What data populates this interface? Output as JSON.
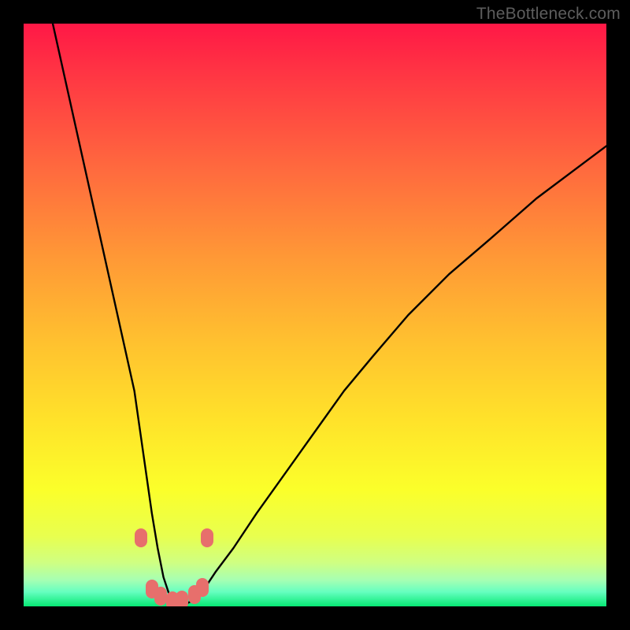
{
  "watermark": {
    "text": "TheBottleneck.com"
  },
  "colors": {
    "marker_fill": "#e76f6c",
    "curve_stroke": "#000000",
    "frame_bg": "#000000",
    "gradient_stops": [
      {
        "offset": 0.0,
        "color": "#ff1846"
      },
      {
        "offset": 0.1,
        "color": "#ff3a43"
      },
      {
        "offset": 0.25,
        "color": "#ff6a3e"
      },
      {
        "offset": 0.4,
        "color": "#ff9836"
      },
      {
        "offset": 0.55,
        "color": "#ffc22f"
      },
      {
        "offset": 0.68,
        "color": "#ffe22a"
      },
      {
        "offset": 0.8,
        "color": "#fbff2a"
      },
      {
        "offset": 0.88,
        "color": "#e8ff4f"
      },
      {
        "offset": 0.925,
        "color": "#cfff82"
      },
      {
        "offset": 0.955,
        "color": "#a6ffb3"
      },
      {
        "offset": 0.975,
        "color": "#66ffc0"
      },
      {
        "offset": 1.0,
        "color": "#07e874"
      }
    ]
  },
  "chart_data": {
    "type": "line",
    "title": "",
    "xlabel": "",
    "ylabel": "",
    "xlim": [
      0,
      100
    ],
    "ylim": [
      0,
      100
    ],
    "grid": false,
    "legend": false,
    "series": [
      {
        "name": "curve",
        "x": [
          5,
          7,
          9,
          11,
          13,
          15,
          17,
          19,
          20,
          21,
          22,
          23,
          24,
          25,
          26,
          27,
          29,
          31,
          33,
          36,
          40,
          45,
          50,
          55,
          60,
          66,
          73,
          80,
          88,
          96,
          100
        ],
        "y": [
          100,
          91,
          82,
          73,
          64,
          55,
          46,
          37,
          30,
          23,
          16,
          10,
          5,
          2,
          0,
          0,
          1,
          3,
          6,
          10,
          16,
          23,
          30,
          37,
          43,
          50,
          57,
          63,
          70,
          76,
          79
        ]
      }
    ],
    "markers": [
      {
        "x": 20.2,
        "y": 11.8
      },
      {
        "x": 22.0,
        "y": 3.0
      },
      {
        "x": 23.5,
        "y": 1.8
      },
      {
        "x": 25.5,
        "y": 1.0
      },
      {
        "x": 27.2,
        "y": 1.1
      },
      {
        "x": 29.3,
        "y": 2.0
      },
      {
        "x": 30.7,
        "y": 3.3
      },
      {
        "x": 31.5,
        "y": 11.8
      }
    ],
    "note": "Axes unlabeled in source image; x treated as 0–100 left→right, y as 0–100 bottom→top. Values are visual estimates."
  }
}
